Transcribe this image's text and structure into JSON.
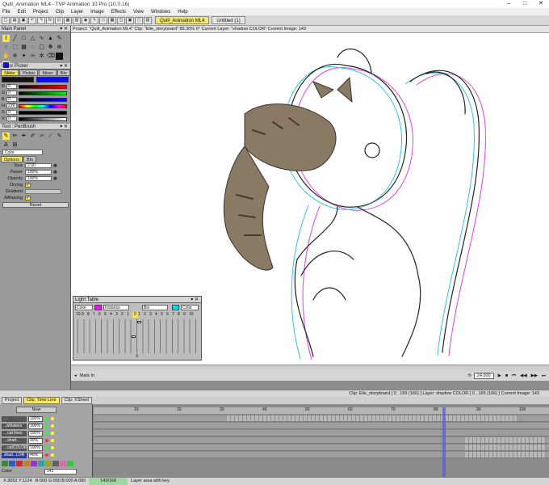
{
  "title_bar": {
    "text": "Quill_Animation ML4 - TVP Animation 10 Pro (10.0.16)"
  },
  "menu": [
    "File",
    "Edit",
    "Project",
    "Clip",
    "Layer",
    "Image",
    "Effects",
    "View",
    "Windows",
    "Help"
  ],
  "doc_tabs": [
    {
      "label": "Quill_Animation ML4",
      "active": true
    },
    {
      "label": "Untitled (1)",
      "active": false
    }
  ],
  "project_bar": "Project: \"Quill_Animation ML4\"  Clip: \"Elie_storyboard\"  86.30%  0°  Current Layer: \"shadow COLOR\"  Current Image: 143",
  "main_panel": {
    "title": "Main Panel"
  },
  "color_picker": {
    "title": "Color Picker",
    "tabs": [
      "Slider",
      "Picker",
      "Mixer",
      "Bin"
    ],
    "rows": [
      {
        "label": "R",
        "value": "0"
      },
      {
        "label": "G",
        "value": "0"
      },
      {
        "label": "B",
        "value": "0"
      },
      {
        "label": "H",
        "value": "239"
      },
      {
        "label": "S",
        "value": "0"
      },
      {
        "label": "V",
        "value": "0"
      }
    ]
  },
  "tool_panel": {
    "title": "Tool : PenBrush",
    "mode": "Color",
    "tabs": [
      "Options",
      "Bin"
    ],
    "props": [
      {
        "label": "Size",
        "value": "2.00"
      },
      {
        "label": "Power",
        "value": "100%"
      },
      {
        "label": "Opacity",
        "value": "100%"
      }
    ],
    "drying_label": "Drying",
    "gradient_label": "Gradient",
    "aaliasing_label": "AAliasing",
    "reset_label": "Reset"
  },
  "light_table": {
    "title": "Light Table",
    "selectors": [
      "Color",
      "Instance",
      "Bin",
      "Color"
    ],
    "numbers_left": [
      "10",
      "9",
      "8",
      "7",
      "6",
      "5",
      "4",
      "3",
      "2",
      "1"
    ],
    "numbers_right": [
      "1",
      "2",
      "3",
      "4",
      "5",
      "6",
      "7",
      "8",
      "9",
      "10"
    ],
    "center": "0",
    "x_label": "X"
  },
  "mark_in": "Mark In",
  "fps": "24.000",
  "status_line": "Clip: Elie_storyboard [ 0 , 165  (166) ]    Layer: shadow COLOR [ 0 , 165  (166) ]    Current Image: 143",
  "timeline_tabs": [
    {
      "label": "Project",
      "active": false
    },
    {
      "label": "Clip: Time Line",
      "active": true
    },
    {
      "label": "Clip: XSheet",
      "active": false
    }
  ],
  "layers": {
    "new_label": "New",
    "rows": [
      {
        "name": "...",
        "opacity": "100%"
      },
      {
        "name": "..whiskers",
        "opacity": "100%"
      },
      {
        "name": "...cat lines",
        "opacity": "100%"
      },
      {
        "name": "...shad...",
        "opacity": "40%"
      },
      {
        "name": "...catCOLOR",
        "opacity": "100%"
      },
      {
        "name": "shad...LOR",
        "opacity": "40%"
      }
    ],
    "color_label": "Color",
    "frame_value": "143"
  },
  "ruler_marks": [
    "10",
    "20",
    "30",
    "40",
    "50",
    "60",
    "70",
    "80",
    "90",
    "100"
  ],
  "footer": {
    "coords": "X:3053  Y:1124",
    "rgba": "R:000 G:000 B:000 A:000",
    "frames": "143/166",
    "hint": "Layer area with key"
  }
}
